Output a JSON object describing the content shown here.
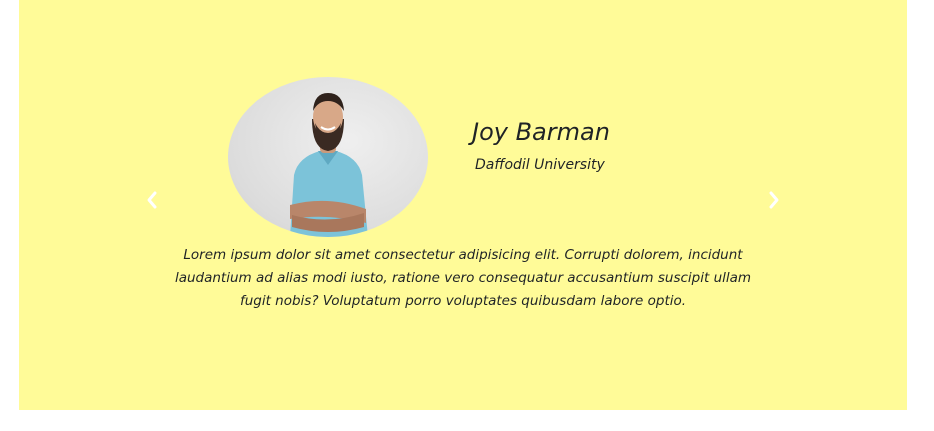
{
  "testimonial": {
    "name": "Joy Barman",
    "organization": "Daffodil University",
    "quote": "Lorem ipsum dolor sit amet consectetur adipisicing elit. Corrupti dolorem, incidunt laudantium ad alias modi iusto, ratione vero consequatur accusantium suscipit ullam fugit nobis? Voluptatum porro voluptates quibusdam labore optio."
  },
  "controls": {
    "prev_icon": "chevron-left-icon",
    "next_icon": "chevron-right-icon"
  },
  "colors": {
    "background": "#fffb98",
    "text": "#1f2326",
    "arrow": "#ffffff"
  }
}
